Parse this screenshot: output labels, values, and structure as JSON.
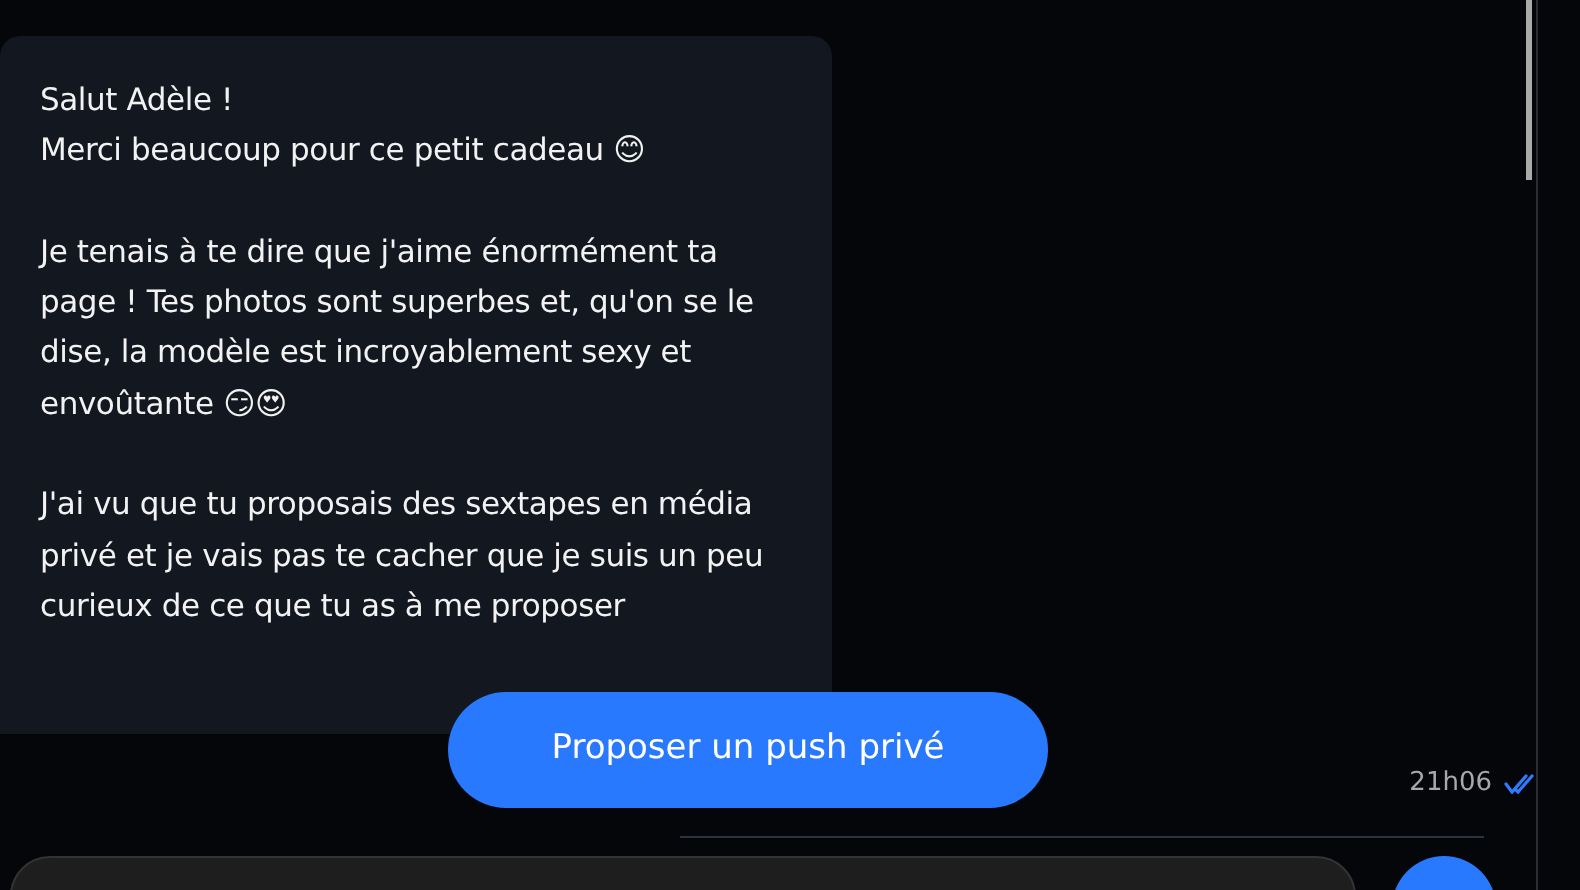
{
  "message": {
    "text": "Salut Adèle !\nMerci beaucoup pour ce petit cadeau 😊\n\nJe tenais à te dire que j'aime énormément ta page ! Tes photos sont superbes et, qu'on se le dise, la modèle est incroyablement sexy et envoûtante 😏😍\n\nJ'ai vu que tu proposais des sextapes en média privé et je vais pas te cacher que je suis un peu curieux de ce que tu as à me proposer",
    "time": "21h06",
    "read": true
  },
  "action_button": {
    "label": "Proposer un push privé"
  }
}
